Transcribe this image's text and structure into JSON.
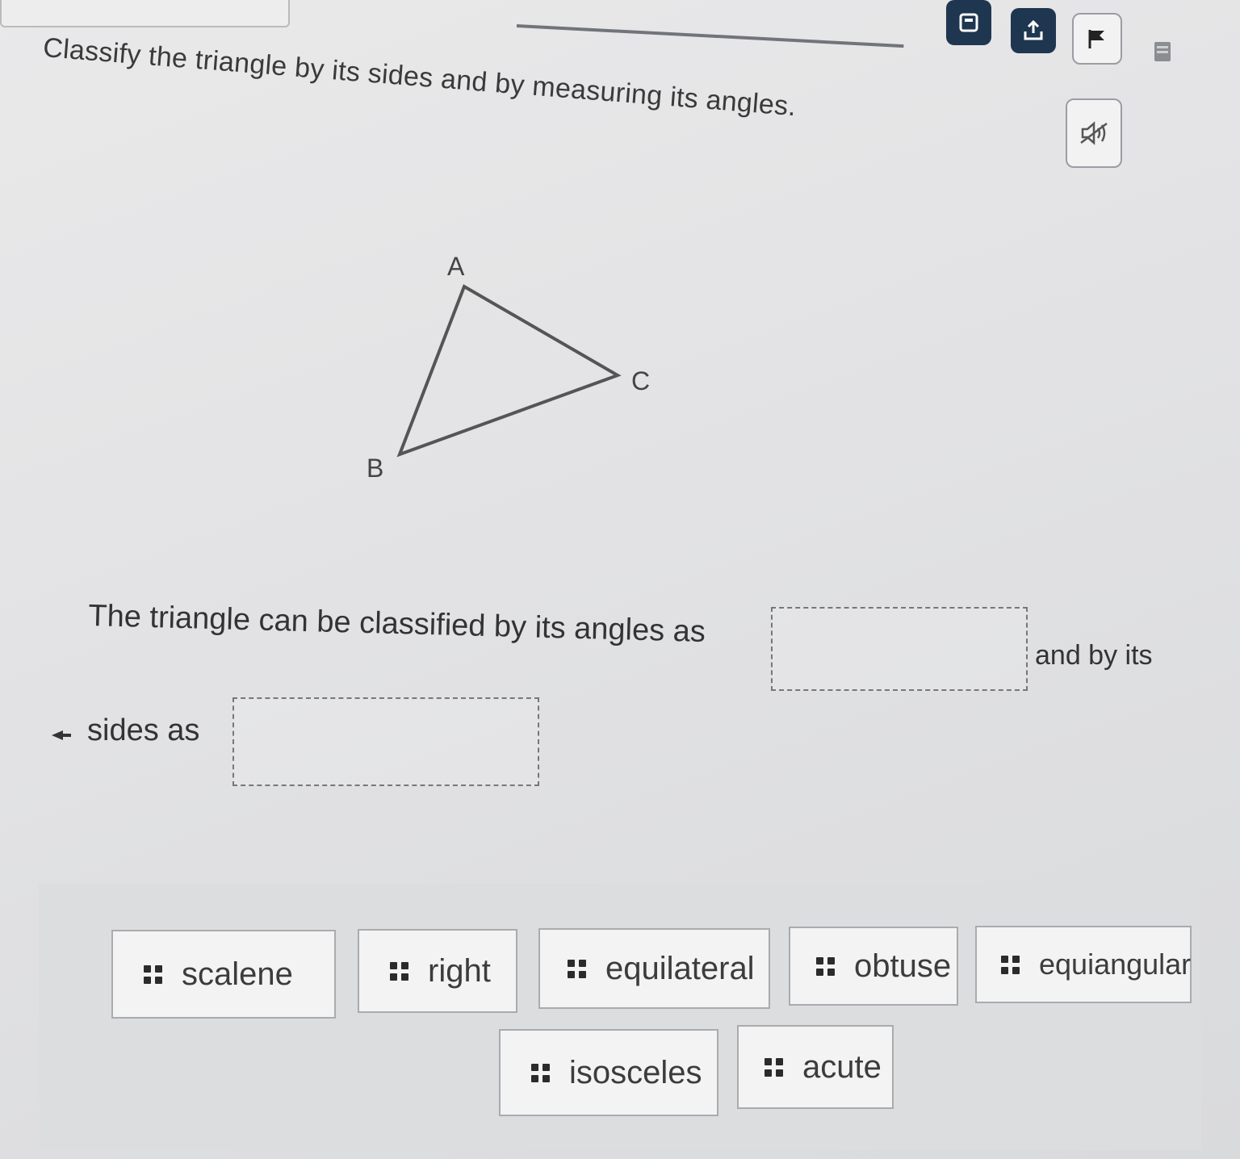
{
  "question": {
    "prompt": "Classify the triangle by its sides and by measuring its angles."
  },
  "toolbar": {
    "icons": [
      "calculator-icon",
      "upload-icon",
      "flag-icon",
      "notepad-icon",
      "audio-icon"
    ]
  },
  "figure": {
    "vertices": [
      "A",
      "B",
      "C"
    ]
  },
  "answer": {
    "part1": "The triangle can be classified by its angles as",
    "part2": "and by its",
    "part3": "sides as",
    "angle_blank_value": "",
    "sides_blank_value": ""
  },
  "word_bank": {
    "options": [
      "scalene",
      "right",
      "equilateral",
      "obtuse",
      "equiangular",
      "isosceles",
      "acute"
    ]
  }
}
